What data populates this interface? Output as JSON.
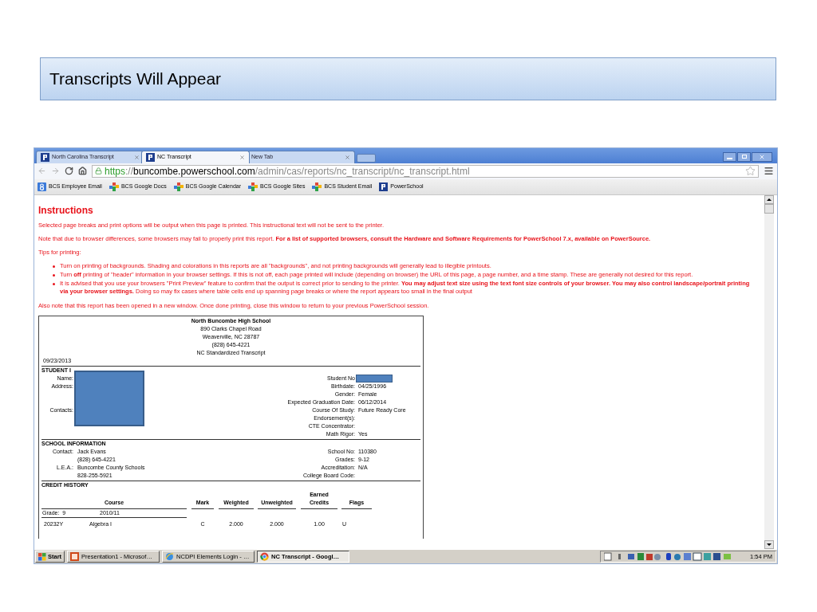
{
  "slide_title": "Transcripts Will Appear",
  "browser": {
    "tabs": [
      {
        "label": "North Carolina Transcript",
        "selected": false
      },
      {
        "label": "NC Transcript",
        "selected": true
      },
      {
        "label": "New Tab",
        "selected": false
      }
    ],
    "address": {
      "scheme": "https",
      "separator": "://",
      "host": "buncombe.powerschool.com",
      "path": "/admin/cas/reports/nc_transcript/nc_transcript.html"
    },
    "bookmarks": [
      {
        "label": "BCS Employee Email",
        "kind": "mail"
      },
      {
        "label": "BCS Google Docs",
        "kind": "apps"
      },
      {
        "label": "BCS Google Calendar",
        "kind": "apps"
      },
      {
        "label": "BCS Google Sites",
        "kind": "apps"
      },
      {
        "label": "BCS Student Email",
        "kind": "apps"
      },
      {
        "label": "PowerSchool",
        "kind": "powerschool"
      }
    ]
  },
  "page": {
    "heading": "Instructions",
    "paragraphs": [
      "Selected page breaks and print options will be output when this page is printed. This instructional text will not be sent to the printer.",
      "Note that due to browser differences, some browsers may fail to properly print this report. **For a list of supported browsers, consult the Hardware and Software Requirements for PowerSchool 7.x, available on PowerSource.**",
      "Tips for printing:"
    ],
    "tips": [
      "Turn on printing of backgrounds. Shading and colorations in this reports are all \"backgrounds\", and not printing backgrounds will generally lead to illegible printouts.",
      "Turn **off** printing of \"header\" information in your browser settings. If this is not off, each page printed will include (depending on browser) the URL of this page, a page number, and a time stamp. These are generally not desired for this report.",
      "It is advised that you use your browsers \"Print Preview\" feature to confirm that the output is correct prior to sending to the printer. **You may adjust text size using the text font size controls of your browser. You may also control landscape/portrait printing via your browser settings.** Doing so may fix cases where table cells end up spanning page breaks or where the report appears too small in the final output"
    ],
    "note": "Also note that this report has been opened in a new window. Once done printing, close this window to return to your previous PowerSchool session."
  },
  "transcript": {
    "school_name": "North Buncombe High School",
    "school_lines": [
      "890 Clarks Chapel Road",
      "Weaverville, NC 28787",
      "(828) 645-4221",
      "NC Standardized Transcript"
    ],
    "date": "09/23/2013",
    "student_heading": "STUDENT I",
    "student_rows": [
      {
        "left_label": "Name:",
        "right_label": "Student No",
        "right_value": ""
      },
      {
        "left_label": "Address:",
        "right_label": "Birthdate:",
        "right_value": "04/25/1996"
      },
      {
        "left_label": "",
        "right_label": "Gender:",
        "right_value": "Female"
      },
      {
        "left_label": "",
        "right_label": "Expected Graduation Date:",
        "right_value": "06/12/2014"
      },
      {
        "left_label": "Contacts:",
        "right_label": "Course Of Study:",
        "right_value": "Future Ready Core"
      },
      {
        "left_label": "",
        "right_label": "Endorsement(s):",
        "right_value": ""
      },
      {
        "left_label": "",
        "right_label": "CTE Concentrator:",
        "right_value": ""
      },
      {
        "left_label": "",
        "right_label": "Math Rigor:",
        "right_value": "Yes"
      }
    ],
    "school_heading": "SCHOOL INFORMATION",
    "school_rows": [
      {
        "left_label": "Contact:",
        "left_value": "Jack Evans",
        "right_label": "School No:",
        "right_value": "110380"
      },
      {
        "left_label": "",
        "left_value": "(828) 645-4221",
        "right_label": "Grades:",
        "right_value": "9-12"
      },
      {
        "left_label": "L.E.A.:",
        "left_value": "Buncombe County Schools",
        "right_label": "Accreditation:",
        "right_value": "N/A"
      },
      {
        "left_label": "",
        "left_value": "828-255-5921",
        "right_label": "College Board Code:",
        "right_value": ""
      }
    ],
    "credit_heading": "CREDIT HISTORY",
    "columns": [
      "Course",
      "Mark",
      "Weighted",
      "Unweighted",
      "Earned Credits",
      "Flags"
    ],
    "grade_group": {
      "grade": "Grade:  9",
      "year": "2010/11"
    },
    "rows": [
      {
        "code": "20232Y",
        "course": "Algebra I",
        "mark": "C",
        "weighted": "2.000",
        "unweighted": "2.000",
        "credits": "1.00",
        "flags": "U"
      }
    ]
  },
  "taskbar": {
    "start": "Start",
    "tasks": [
      {
        "label": "Presentation1 - Microsof…",
        "kind": "slides",
        "selected": false
      },
      {
        "label": "NCDPI Elements Login - …",
        "kind": "ie",
        "selected": false
      },
      {
        "label": "NC Transcript - Googl…",
        "kind": "chrome",
        "selected": true
      }
    ],
    "clock": "1:54 PM"
  }
}
